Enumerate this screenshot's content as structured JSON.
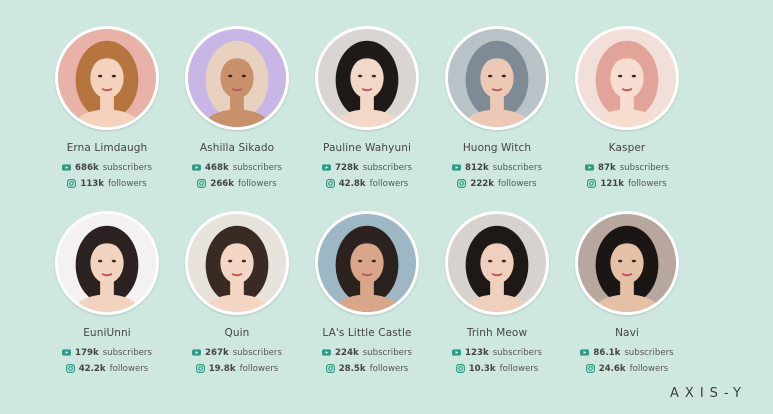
{
  "brand": {
    "logo_text": "AXIS-Y"
  },
  "influencers": [
    {
      "name": "Erna Limdaugh",
      "subscribers": "686k",
      "followers": "113k",
      "bg": "#e8b2a8",
      "hair": "#b6753f",
      "skin": "#f4d2bd"
    },
    {
      "name": "Ashilla Sikado",
      "subscribers": "468k",
      "followers": "266k",
      "bg": "#c8b7e6",
      "hair": "#e8d2bf",
      "skin": "#c9906c"
    },
    {
      "name": "Pauline Wahyuni",
      "subscribers": "728k",
      "followers": "42.8k",
      "bg": "#d9d6d1",
      "hair": "#1f1a18",
      "skin": "#f2d8c8"
    },
    {
      "name": "Huong Witch",
      "subscribers": "812k",
      "followers": "222k",
      "bg": "#b9c2c6",
      "hair": "#7e8b95",
      "skin": "#ecc9b4"
    },
    {
      "name": "Kasper",
      "subscribers": "87k",
      "followers": "121k",
      "bg": "#f2dfd9",
      "hair": "#e2a39a",
      "skin": "#f6ddd0"
    },
    {
      "name": "EuniUnni",
      "subscribers": "179k",
      "followers": "42.2k",
      "bg": "#f3f2f1",
      "hair": "#2a2120",
      "skin": "#f2d3c0"
    },
    {
      "name": "Quin",
      "subscribers": "267k",
      "followers": "19.8k",
      "bg": "#e7e3dc",
      "hair": "#3a2a24",
      "skin": "#f3d6c3"
    },
    {
      "name": "LA's Little Castle",
      "subscribers": "224k",
      "followers": "28.5k",
      "bg": "#9eb7c4",
      "hair": "#2b2220",
      "skin": "#d9a689"
    },
    {
      "name": "Trinh Meow",
      "subscribers": "123k",
      "followers": "10.3k",
      "bg": "#d8d2cf",
      "hair": "#1e1816",
      "skin": "#efd0bd"
    },
    {
      "name": "Navi",
      "subscribers": "86.1k",
      "followers": "24.6k",
      "bg": "#b7a79e",
      "hair": "#1b1513",
      "skin": "#e6bfa7"
    }
  ],
  "labels": {
    "subscribers": "subscribers",
    "followers": "followers"
  },
  "icons": {
    "youtube": "youtube-icon",
    "instagram": "instagram-icon"
  },
  "colors": {
    "background": "#cfe8df",
    "icon_green": "#2e9b84"
  }
}
